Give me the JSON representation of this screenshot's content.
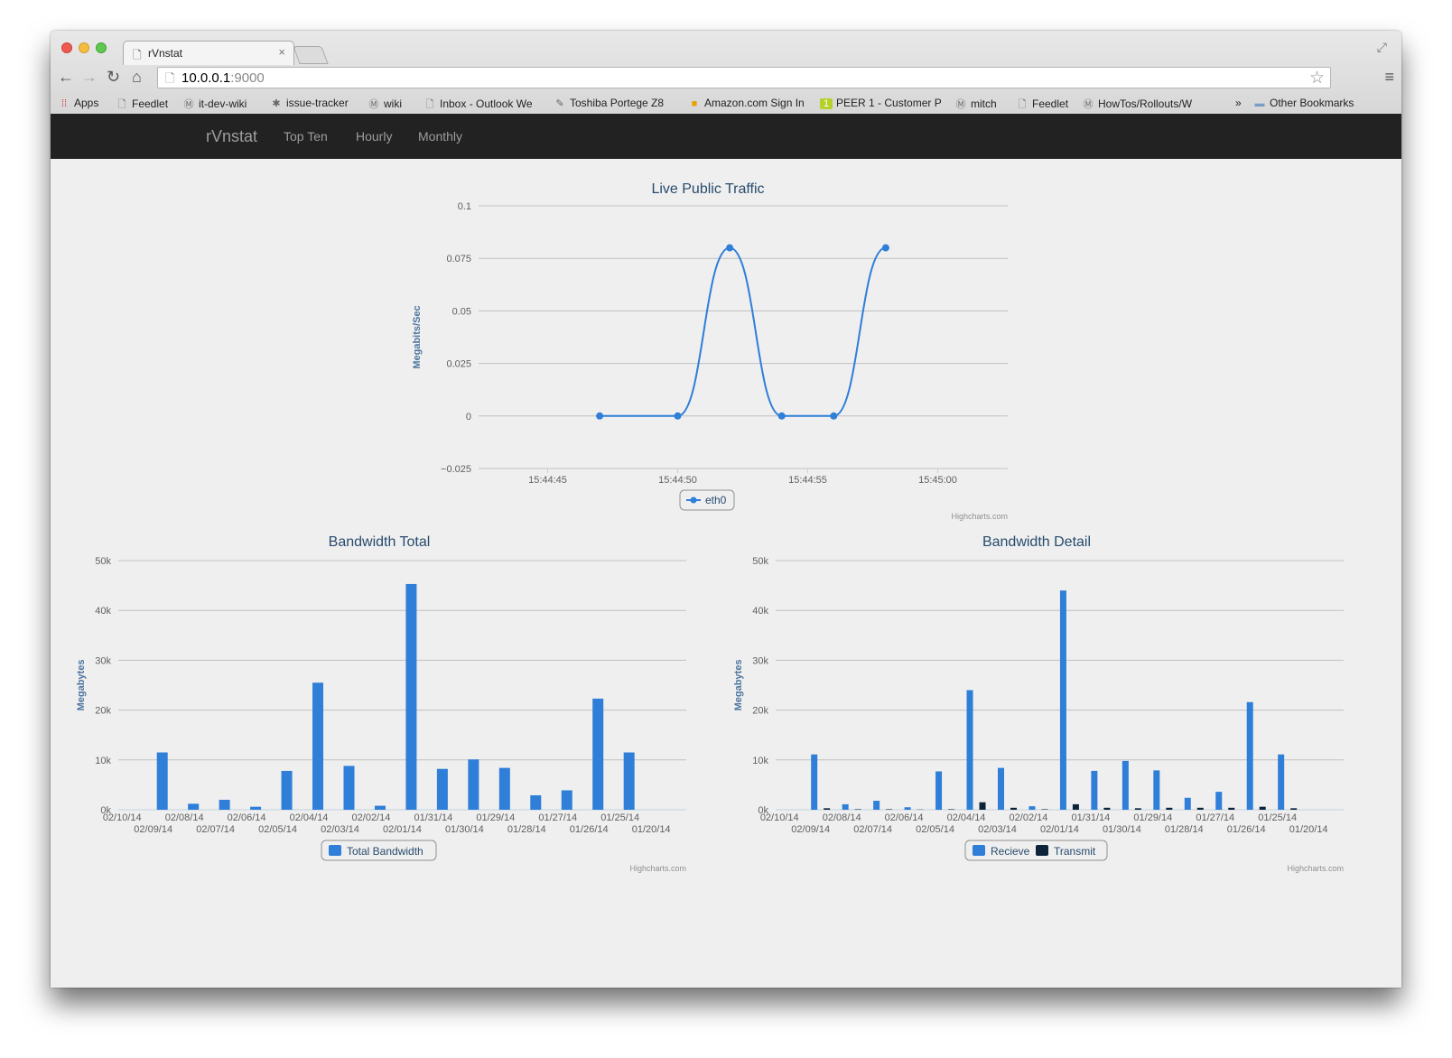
{
  "browser": {
    "tab_title": "rVnstat",
    "url_host": "10.0.0.1",
    "url_port": ":9000",
    "bookmarks": [
      {
        "label": "Apps",
        "icon": "apps-grid-icon"
      },
      {
        "label": "Feedlet",
        "icon": "page-icon"
      },
      {
        "label": "it-dev-wiki",
        "icon": "m-logo-icon"
      },
      {
        "label": "issue-tracker",
        "icon": "bug-icon"
      },
      {
        "label": "wiki",
        "icon": "m-logo-icon"
      },
      {
        "label": "Inbox - Outlook We",
        "icon": "page-icon"
      },
      {
        "label": "Toshiba Portege Z8",
        "icon": "leaf-icon"
      },
      {
        "label": "Amazon.com Sign In",
        "icon": "box-icon"
      },
      {
        "label": "PEER 1 - Customer P",
        "icon": "peer1-icon"
      },
      {
        "label": "mitch",
        "icon": "m-logo-icon"
      },
      {
        "label": "Feedlet",
        "icon": "page-icon"
      },
      {
        "label": "HowTos/Rollouts/W",
        "icon": "m-logo-icon"
      }
    ],
    "overflow_label": "»",
    "other_bookmarks": "Other Bookmarks"
  },
  "nav": {
    "brand": "rVnstat",
    "links": [
      "Top Ten",
      "Hourly",
      "Monthly"
    ]
  },
  "credits": "Highcharts.com",
  "colors": {
    "blue": "#2f7ed8",
    "dark": "#0d233a",
    "title": "#274b6d",
    "axis": "#4d759e"
  },
  "chart_data": [
    {
      "type": "line",
      "title": "Live Public Traffic",
      "ylabel": "Megabits/Sec",
      "ylim": [
        -0.025,
        0.1
      ],
      "yticks": [
        "−0.025",
        "0",
        "0.025",
        "0.05",
        "0.075",
        "0.1"
      ],
      "xticks": [
        "15:44:45",
        "15:44:50",
        "15:44:55",
        "15:45:00"
      ],
      "series": [
        {
          "name": "eth0",
          "x": [
            "15:44:47",
            "15:44:50",
            "15:44:52",
            "15:44:54",
            "15:44:56",
            "15:44:58"
          ],
          "values": [
            0,
            0,
            0.08,
            0,
            0,
            0.08
          ]
        }
      ]
    },
    {
      "type": "bar",
      "title": "Bandwidth Total",
      "ylabel": "Megabytes",
      "ylim": [
        0,
        50000
      ],
      "yticks": [
        "0k",
        "10k",
        "20k",
        "30k",
        "40k",
        "50k"
      ],
      "categories": [
        "02/10/14",
        "02/09/14",
        "02/08/14",
        "02/07/14",
        "02/06/14",
        "02/05/14",
        "02/04/14",
        "02/03/14",
        "02/02/14",
        "02/01/14",
        "01/31/14",
        "01/30/14",
        "01/29/14",
        "01/28/14",
        "01/27/14",
        "01/26/14",
        "01/25/14",
        "01/20/14"
      ],
      "series": [
        {
          "name": "Total Bandwidth",
          "values": [
            0,
            11500,
            1200,
            2000,
            600,
            7800,
            25500,
            8800,
            800,
            45300,
            8200,
            10100,
            8400,
            2900,
            3900,
            22300,
            11500,
            0
          ]
        }
      ]
    },
    {
      "type": "bar",
      "title": "Bandwidth Detail",
      "ylabel": "Megabytes",
      "ylim": [
        0,
        50000
      ],
      "yticks": [
        "0k",
        "10k",
        "20k",
        "30k",
        "40k",
        "50k"
      ],
      "categories": [
        "02/10/14",
        "02/09/14",
        "02/08/14",
        "02/07/14",
        "02/06/14",
        "02/05/14",
        "02/04/14",
        "02/03/14",
        "02/02/14",
        "02/01/14",
        "01/31/14",
        "01/30/14",
        "01/29/14",
        "01/28/14",
        "01/27/14",
        "01/26/14",
        "01/25/14",
        "01/20/14"
      ],
      "series": [
        {
          "name": "Recieve",
          "values": [
            0,
            11100,
            1100,
            1800,
            500,
            7700,
            24000,
            8400,
            700,
            44000,
            7800,
            9800,
            7900,
            2400,
            3600,
            21600,
            11100,
            0
          ]
        },
        {
          "name": "Transmit",
          "values": [
            0,
            300,
            100,
            100,
            50,
            100,
            1500,
            400,
            100,
            1100,
            400,
            300,
            400,
            400,
            400,
            600,
            300,
            0
          ]
        }
      ]
    }
  ]
}
